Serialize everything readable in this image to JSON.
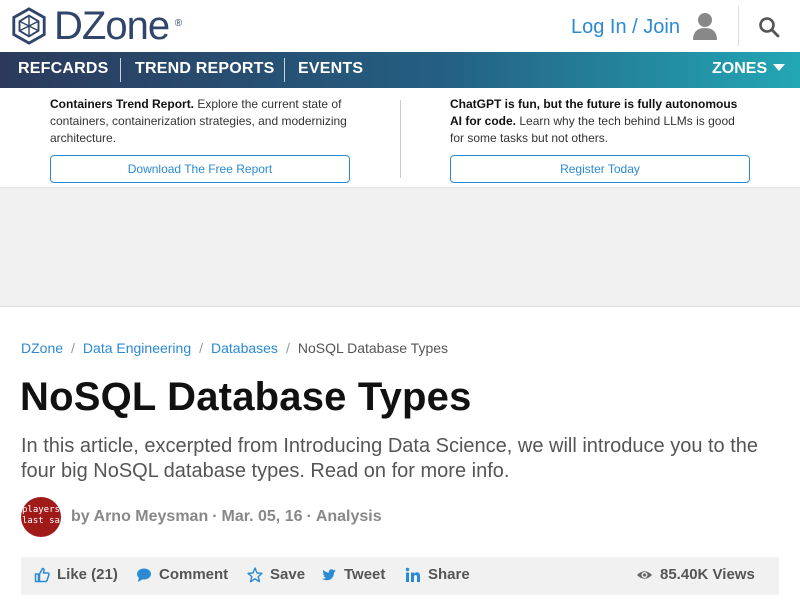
{
  "header": {
    "logo_text": "DZone",
    "logo_reg": "®",
    "login_label": "Log In / Join",
    "user_icon": "user-icon",
    "search_icon": "search-icon"
  },
  "nav": {
    "items": [
      {
        "label": "REFCARDS"
      },
      {
        "label": "TREND REPORTS"
      },
      {
        "label": "EVENTS"
      }
    ],
    "zones_label": "ZONES"
  },
  "promo": {
    "left": {
      "bold": "Containers Trend Report.",
      "text": " Explore the current state of containers, containerization strategies, and modernizing architecture.",
      "button": "Download The Free Report"
    },
    "right": {
      "bold": "ChatGPT is fun, but the future is fully autonomous AI for code.",
      "text": " Learn why the tech behind LLMs is good for some tasks but not others.",
      "button": "Register Today"
    }
  },
  "breadcrumb": {
    "items": [
      "DZone",
      "Data Engineering",
      "Databases"
    ],
    "current": "NoSQL Database Types",
    "separator": "/"
  },
  "article": {
    "title": "NoSQL Database Types",
    "summary": "In this article, excerpted from Introducing Data Science, we will introduce you to the four big NoSQL database types. Read on for more info.",
    "avatar_text_1": "players",
    "avatar_text_2": "last sa",
    "author": "by Arno Meysman",
    "date": "Mar. 05, 16",
    "category": "Analysis",
    "meta_separator": "·"
  },
  "actions": {
    "like": "Like (21)",
    "comment": "Comment",
    "save": "Save",
    "tweet": "Tweet",
    "share": "Share",
    "views": "85.40K Views"
  },
  "colors": {
    "brand": "#31446a",
    "link": "#2a8ad3",
    "nav_start": "#2b3a5c",
    "nav_end": "#23a7b5"
  }
}
